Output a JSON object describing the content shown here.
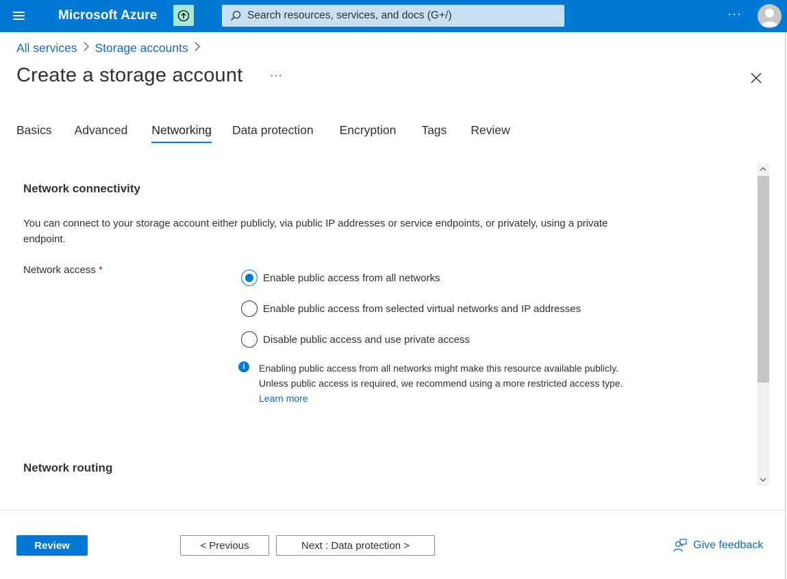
{
  "header": {
    "brand": "Microsoft Azure",
    "search_placeholder": "Search resources, services, and docs (G+/)",
    "more": "···",
    "colors": {
      "bar": "#0078d4",
      "upgrade_bg": "#a6e9d5",
      "search_bg": "#c7e0f4"
    },
    "icons": [
      "hamburger-menu-icon",
      "upgrade-icon",
      "search-icon",
      "avatar"
    ]
  },
  "breadcrumb": {
    "items": [
      {
        "label": "All services"
      },
      {
        "label": "Storage accounts"
      }
    ]
  },
  "page": {
    "title": "Create a storage account",
    "more": "···"
  },
  "tabs": [
    {
      "label": "Basics",
      "active": false
    },
    {
      "label": "Advanced",
      "active": false
    },
    {
      "label": "Networking",
      "active": true
    },
    {
      "label": "Data protection",
      "active": false
    },
    {
      "label": "Encryption",
      "active": false
    },
    {
      "label": "Tags",
      "active": false
    },
    {
      "label": "Review",
      "active": false
    }
  ],
  "network_connectivity": {
    "heading": "Network connectivity",
    "description": "You can connect to your storage account either publicly, via public IP addresses or service endpoints, or privately, using a private endpoint.",
    "field_label": "Network access",
    "required_mark": "*",
    "options": [
      {
        "label": "Enable public access from all networks",
        "selected": true
      },
      {
        "label": "Enable public access from selected virtual networks and IP addresses",
        "selected": false
      },
      {
        "label": "Disable public access and use private access",
        "selected": false
      }
    ],
    "info_text": "Enabling public access from all networks might make this resource available publicly. Unless public access is required, we recommend using a more restricted access type.",
    "info_link": "Learn more"
  },
  "network_routing": {
    "heading": "Network routing"
  },
  "footer": {
    "review_label": "Review",
    "previous_label": "< Previous",
    "next_label": "Next : Data protection >",
    "feedback_label": "Give feedback"
  }
}
